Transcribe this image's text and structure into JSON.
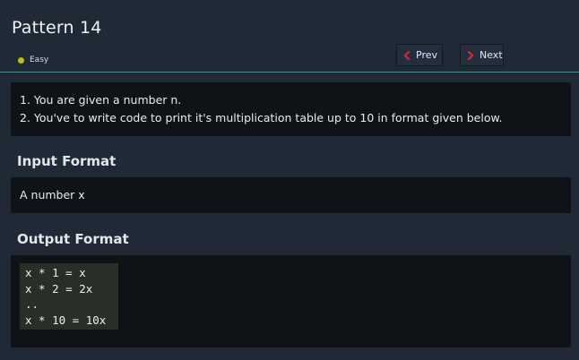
{
  "problem": {
    "title": "Pattern 14",
    "difficulty": "Easy",
    "difficulty_color": "#b5c41a"
  },
  "nav": {
    "prev_label": "Prev",
    "next_label": "Next",
    "prev_icon": "chevron-left-icon",
    "next_icon": "chevron-right-icon",
    "icon_color": "#e0243a"
  },
  "description": {
    "lines": [
      "1. You are given a number n.",
      "2. You've to write code to print it's multiplication table up to 10 in format given below."
    ]
  },
  "input_format": {
    "heading": "Input Format",
    "text": "A number x"
  },
  "output_format": {
    "heading": "Output Format",
    "code_lines": [
      "x * 1 = x",
      "x * 2 = 2x",
      "..",
      "x * 10 = 10x"
    ]
  }
}
